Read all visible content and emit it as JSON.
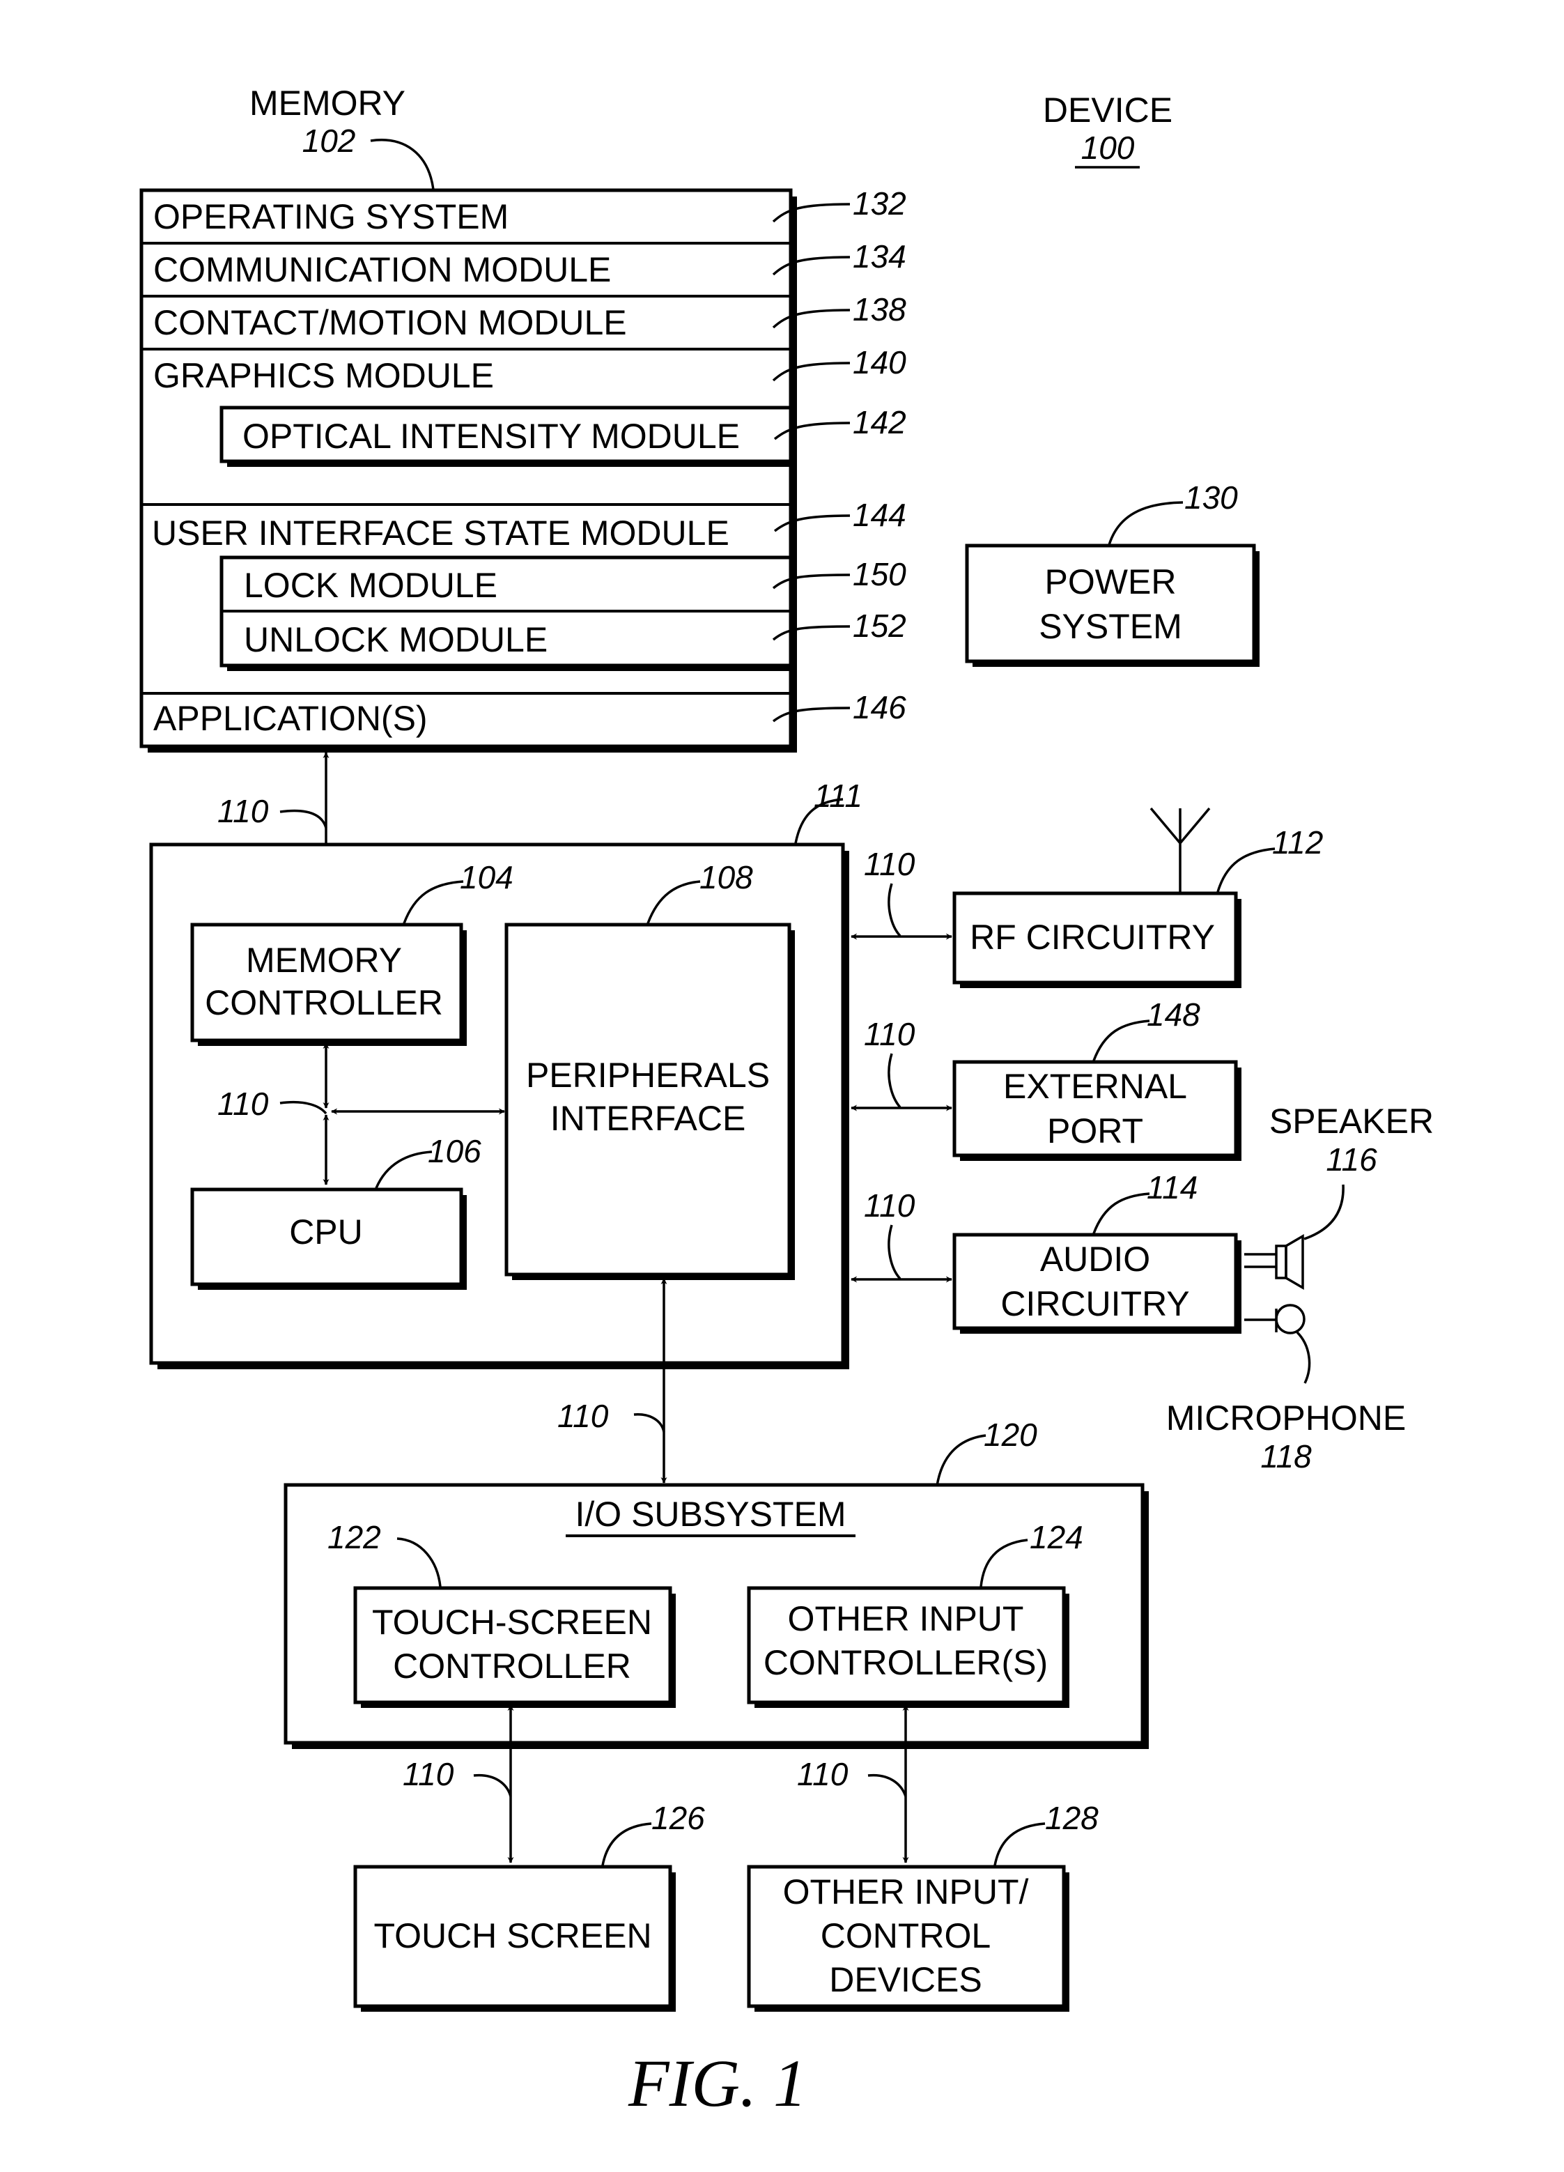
{
  "device": {
    "label": "DEVICE",
    "ref": "100"
  },
  "memory": {
    "label": "MEMORY",
    "ref": "102",
    "rows": [
      {
        "label": "OPERATING SYSTEM",
        "ref": "132"
      },
      {
        "label": "COMMUNICATION MODULE",
        "ref": "134"
      },
      {
        "label": "CONTACT/MOTION MODULE",
        "ref": "138"
      },
      {
        "label": "GRAPHICS MODULE",
        "ref": "140"
      },
      {
        "label": "OPTICAL INTENSITY MODULE",
        "ref": "142"
      },
      {
        "label": "USER INTERFACE STATE MODULE",
        "ref": "144"
      },
      {
        "label": "LOCK MODULE",
        "ref": "150"
      },
      {
        "label": "UNLOCK MODULE",
        "ref": "152"
      },
      {
        "label": "APPLICATION(S)",
        "ref": "146"
      }
    ]
  },
  "power_system": {
    "line1": "POWER",
    "line2": "SYSTEM",
    "ref": "130"
  },
  "chip": {
    "ref": "111"
  },
  "memory_controller": {
    "line1": "MEMORY",
    "line2": "CONTROLLER",
    "ref": "104"
  },
  "cpu": {
    "label": "CPU",
    "ref": "106"
  },
  "peripherals_interface": {
    "line1": "PERIPHERALS",
    "line2": "INTERFACE",
    "ref": "108"
  },
  "bus": {
    "ref": "110"
  },
  "rf_circuitry": {
    "label": "RF CIRCUITRY",
    "ref": "112"
  },
  "external_port": {
    "line1": "EXTERNAL",
    "line2": "PORT",
    "ref": "148"
  },
  "audio_circuitry": {
    "line1": "AUDIO",
    "line2": "CIRCUITRY",
    "ref": "114"
  },
  "speaker": {
    "label": "SPEAKER",
    "ref": "116"
  },
  "microphone": {
    "label": "MICROPHONE",
    "ref": "118"
  },
  "io_subsystem": {
    "label": "I/O SUBSYSTEM",
    "ref": "120"
  },
  "touch_screen_controller": {
    "line1": "TOUCH-SCREEN",
    "line2": "CONTROLLER",
    "ref": "122"
  },
  "other_input_controllers": {
    "line1": "OTHER INPUT",
    "line2": "CONTROLLER(S)",
    "ref": "124"
  },
  "touch_screen": {
    "label": "TOUCH SCREEN",
    "ref": "126"
  },
  "other_input_devices": {
    "line1": "OTHER INPUT/",
    "line2": "CONTROL",
    "line3": "DEVICES",
    "ref": "128"
  },
  "figure_caption": "FIG. 1"
}
